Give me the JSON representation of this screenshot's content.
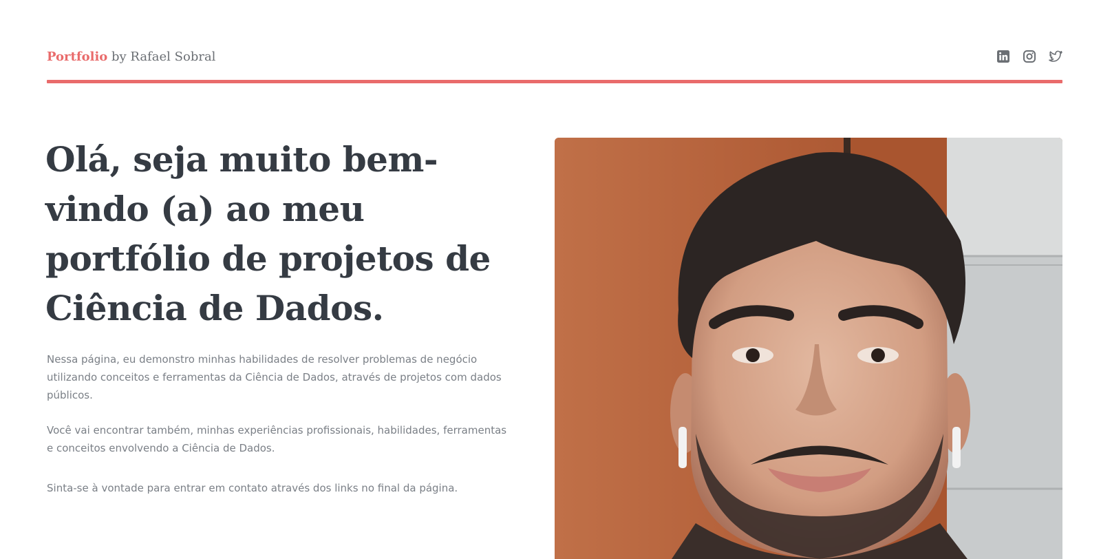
{
  "header": {
    "brand_accent": "Portfolio",
    "brand_rest": " by Rafael Sobral",
    "social_icons": [
      "linkedin-icon",
      "instagram-icon",
      "twitter-icon"
    ]
  },
  "hero": {
    "title": "Olá, seja muito bem-vindo (a) ao meu portfólio de projetos de Ciência de Dados.",
    "paragraph_1": "Nessa página, eu demonstro minhas habilidades de resolver problemas de negócio utilizando conceitos e ferramentas da Ciência de Dados, através de projetos com dados públicos.",
    "paragraph_2": "Você vai encontrar também, minhas experiências profissionais, habilidades, ferramentas e conceitos envolvendo a Ciência de Dados.",
    "paragraph_3": "Sinta-se à vontade para entrar em contato através dos links no final da página."
  },
  "colors": {
    "accent": "#e96b6b",
    "heading": "#353b43",
    "body_text": "#7a7f86",
    "icon": "#6b6f74"
  }
}
